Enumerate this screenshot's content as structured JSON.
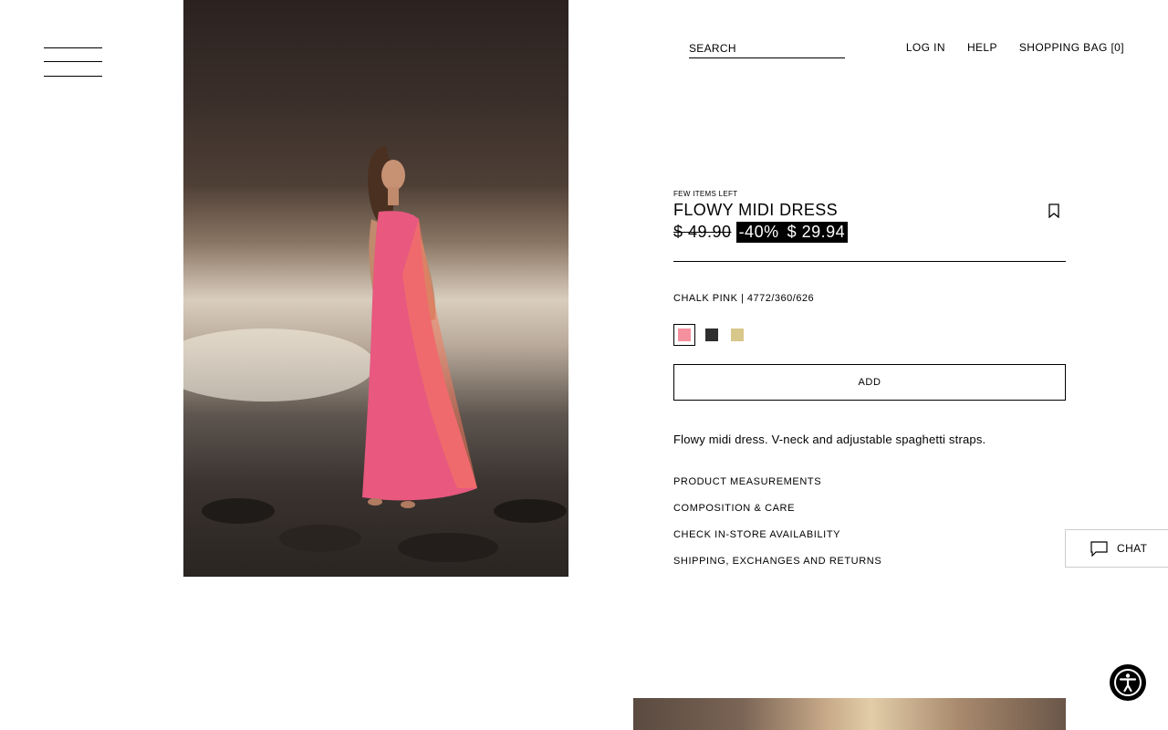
{
  "header": {
    "search_placeholder": "SEARCH",
    "login_label": "LOG IN",
    "help_label": "HELP",
    "bag_label": "SHOPPING BAG [0]"
  },
  "product": {
    "stock_label": "FEW ITEMS LEFT",
    "name": "FLOWY MIDI DRESS",
    "original_price": "$ 49.90",
    "discount": "-40%",
    "sale_price": "$ 29.94",
    "color_line": "CHALK PINK | 4772/360/626",
    "swatches": [
      {
        "name": "chalk-pink",
        "color": "#f5909e",
        "selected": true
      },
      {
        "name": "black",
        "color": "#2e2e2e",
        "selected": false
      },
      {
        "name": "khaki",
        "color": "#d8c78a",
        "selected": false
      }
    ],
    "add_label": "ADD",
    "description": "Flowy midi dress. V-neck and adjustable spaghetti straps.",
    "accordion": [
      "PRODUCT MEASUREMENTS",
      "COMPOSITION & CARE",
      "CHECK IN-STORE AVAILABILITY",
      "SHIPPING, EXCHANGES AND RETURNS"
    ]
  },
  "chat": {
    "label": "CHAT"
  },
  "icons": {
    "menu": "hamburger-icon",
    "bookmark": "bookmark-icon",
    "chat": "chat-icon",
    "accessibility": "accessibility-icon"
  }
}
